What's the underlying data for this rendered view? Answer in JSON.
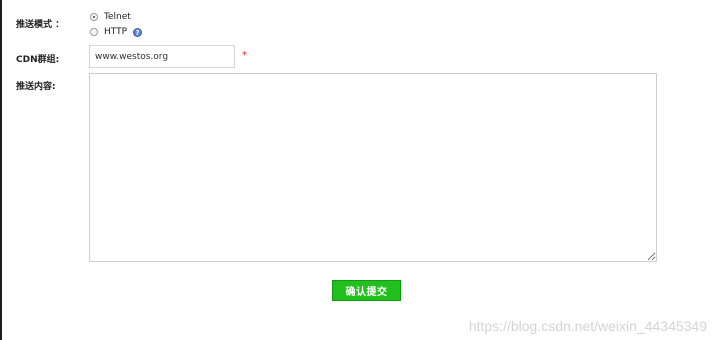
{
  "form": {
    "push_mode_label": "推送模式 ：",
    "modes": [
      {
        "label": "Telnet",
        "selected": true
      },
      {
        "label": "HTTP",
        "selected": false
      }
    ],
    "help_icon": "question-mark",
    "cdn_group_label": "CDN群组:",
    "cdn_group_value": "www.westos.org",
    "required_mark": "*",
    "push_content_label": "推送内容:",
    "push_content_value": "",
    "submit_label": "确认提交"
  },
  "watermark": "https://blog.csdn.net/weixin_44345349",
  "colors": {
    "submit_bg": "#22c01e",
    "required": "#e02020",
    "help_icon": "#5a7fd0"
  }
}
